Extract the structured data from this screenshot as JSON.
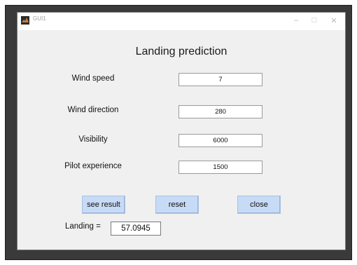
{
  "window": {
    "title": "GUI1",
    "icon": "matlab-icon"
  },
  "heading": "Landing prediction",
  "inputs": [
    {
      "label": "Wind speed",
      "value": "7"
    },
    {
      "label": "Wind direction",
      "value": "280"
    },
    {
      "label": "Visibility",
      "value": "6000"
    },
    {
      "label": "Pilot experience",
      "value": "1500"
    }
  ],
  "buttons": {
    "see_result": "see result",
    "reset": "reset",
    "close": "close"
  },
  "result": {
    "label": "Landing =",
    "value": "57.0945"
  },
  "colors": {
    "button_bg": "#c7dbf6",
    "window_bg": "#f0f0f0",
    "frame": "#3a3a3a"
  }
}
